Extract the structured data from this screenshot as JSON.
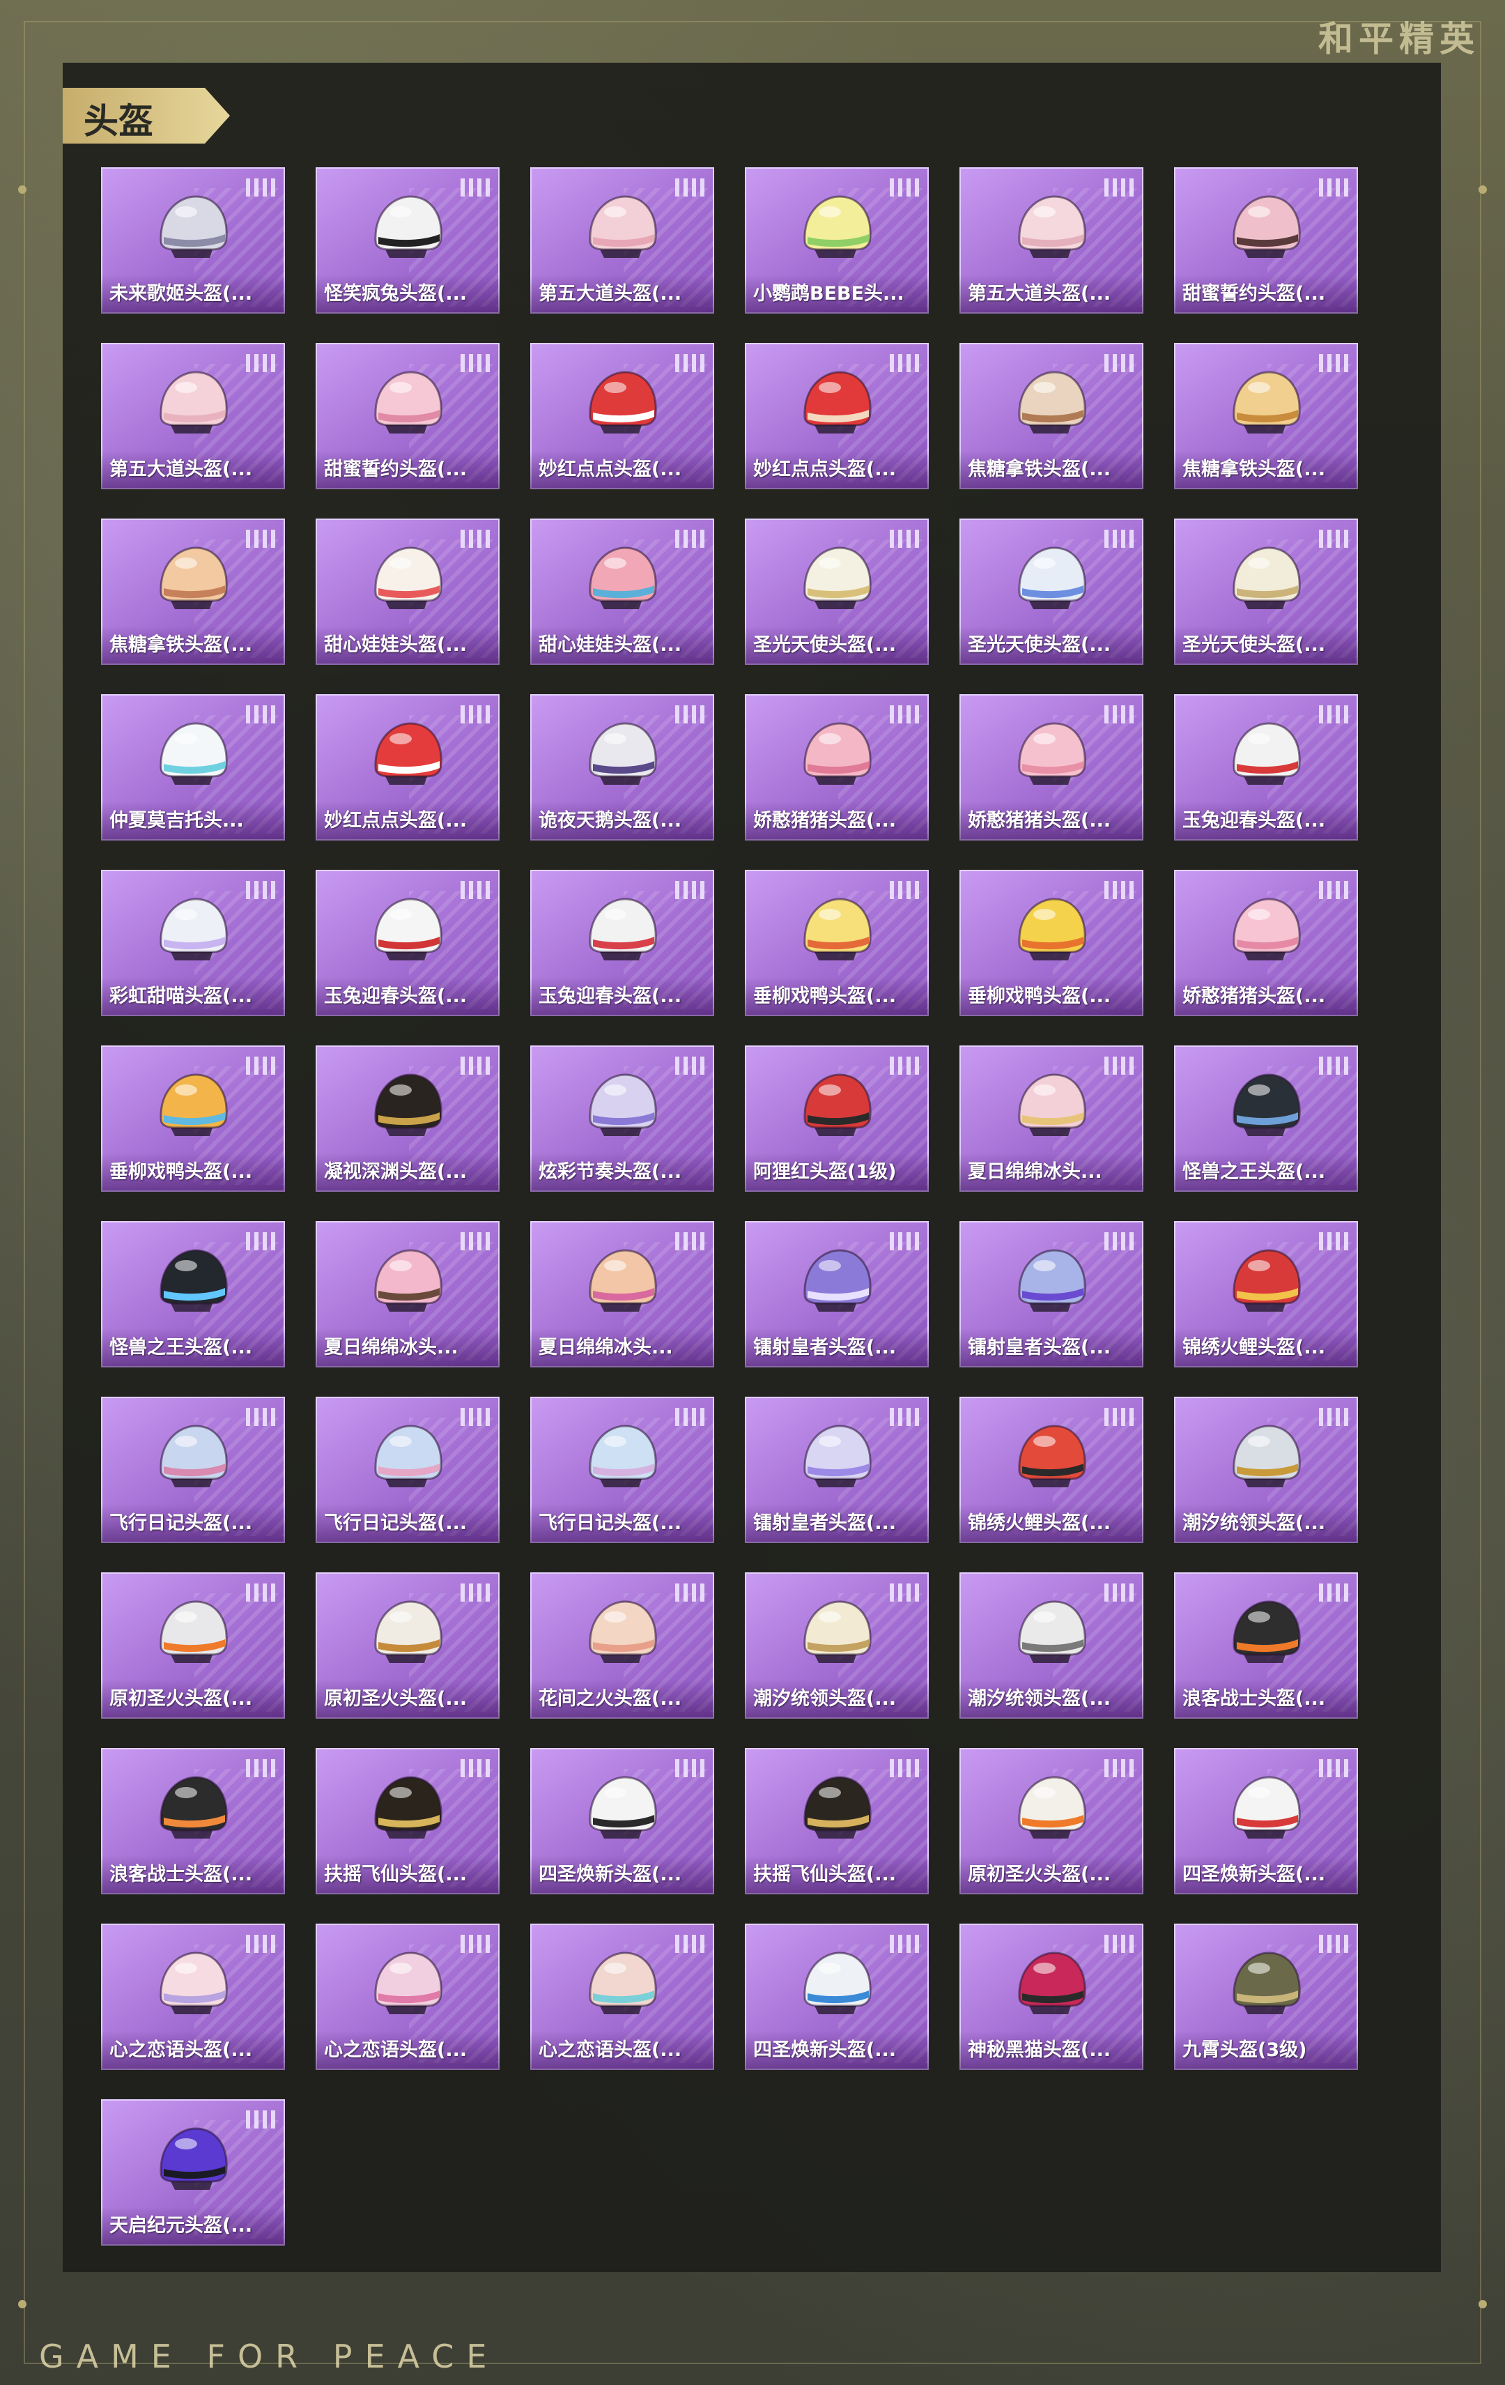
{
  "header": {
    "game_title": "和平精英"
  },
  "section": {
    "title": "头盔"
  },
  "footer": {
    "slogan": "GAME FOR PEACE"
  },
  "items": [
    {
      "name": "未来歌姬头盔(...",
      "color": "#d9d9e6",
      "accent": "#8c8ca8"
    },
    {
      "name": "怪笑疯兔头盔(...",
      "color": "#f2f2f2",
      "accent": "#222222"
    },
    {
      "name": "第五大道头盔(...",
      "color": "#f3cfd7",
      "accent": "#e8a7b5"
    },
    {
      "name": "小鹦鹉BEBE头...",
      "color": "#f3ee9a",
      "accent": "#8fcf66"
    },
    {
      "name": "第五大道头盔(...",
      "color": "#f5d7de",
      "accent": "#e4b0bb"
    },
    {
      "name": "甜蜜誓约头盔(...",
      "color": "#efc0cb",
      "accent": "#5a3a3a"
    },
    {
      "name": "第五大道头盔(...",
      "color": "#f5d2d9",
      "accent": "#e8b2bf"
    },
    {
      "name": "甜蜜誓约头盔(...",
      "color": "#f6c8d6",
      "accent": "#e08aa6"
    },
    {
      "name": "妙红点点头盔(...",
      "color": "#e03b3b",
      "accent": "#ffffff"
    },
    {
      "name": "妙红点点头盔(...",
      "color": "#e23a3a",
      "accent": "#f4d9c0"
    },
    {
      "name": "焦糖拿铁头盔(...",
      "color": "#ead4bf",
      "accent": "#b07a55"
    },
    {
      "name": "焦糖拿铁头盔(...",
      "color": "#f1cf8f",
      "accent": "#c98b3c"
    },
    {
      "name": "焦糖拿铁头盔(...",
      "color": "#f2c9a0",
      "accent": "#c6805a"
    },
    {
      "name": "甜心娃娃头盔(...",
      "color": "#f7f1ea",
      "accent": "#e85a5a"
    },
    {
      "name": "甜心娃娃头盔(...",
      "color": "#f2a7b6",
      "accent": "#5ab0d8"
    },
    {
      "name": "圣光天使头盔(...",
      "color": "#f4f1e2",
      "accent": "#d8c07a"
    },
    {
      "name": "圣光天使头盔(...",
      "color": "#e7edf7",
      "accent": "#6c8fe0"
    },
    {
      "name": "圣光天使头盔(...",
      "color": "#f2ecda",
      "accent": "#cbb37a"
    },
    {
      "name": "仲夏莫吉托头...",
      "color": "#f4f7fa",
      "accent": "#6fd0e0"
    },
    {
      "name": "妙红点点头盔(...",
      "color": "#e43c3c",
      "accent": "#ffffff"
    },
    {
      "name": "诡夜天鹅头盔(...",
      "color": "#e8e8ee",
      "accent": "#5a4a8a"
    },
    {
      "name": "娇憨猪猪头盔(...",
      "color": "#f4b7c6",
      "accent": "#e07a96"
    },
    {
      "name": "娇憨猪猪头盔(...",
      "color": "#f6c1cf",
      "accent": "#e890a6"
    },
    {
      "name": "玉兔迎春头盔(...",
      "color": "#f2f2f2",
      "accent": "#d83a3a"
    },
    {
      "name": "彩虹甜喵头盔(...",
      "color": "#eef0f8",
      "accent": "#c7b4f0"
    },
    {
      "name": "玉兔迎春头盔(...",
      "color": "#f5f5f5",
      "accent": "#d13535"
    },
    {
      "name": "玉兔迎春头盔(...",
      "color": "#f2f2f2",
      "accent": "#d8404a"
    },
    {
      "name": "垂柳戏鸭头盔(...",
      "color": "#f7df7a",
      "accent": "#e46a3a"
    },
    {
      "name": "垂柳戏鸭头盔(...",
      "color": "#f5d24c",
      "accent": "#e8732e"
    },
    {
      "name": "娇憨猪猪头盔(...",
      "color": "#f7c4d3",
      "accent": "#e689a5"
    },
    {
      "name": "垂柳戏鸭头盔(...",
      "color": "#f3b54a",
      "accent": "#5fb9e0"
    },
    {
      "name": "凝视深渊头盔(...",
      "color": "#2a2420",
      "accent": "#c9a24a"
    },
    {
      "name": "炫彩节奏头盔(...",
      "color": "#d8d2f0",
      "accent": "#8a7ad6"
    },
    {
      "name": "阿狸红头盔(1级)",
      "color": "#d83a3a",
      "accent": "#2a2a2a"
    },
    {
      "name": "夏日绵绵冰头...",
      "color": "#f3d0d8",
      "accent": "#e8c47a"
    },
    {
      "name": "怪兽之王头盔(...",
      "color": "#2a3038",
      "accent": "#6ea0d8"
    },
    {
      "name": "怪兽之王头盔(...",
      "color": "#23282e",
      "accent": "#63c7ff"
    },
    {
      "name": "夏日绵绵冰头...",
      "color": "#f3b8cc",
      "accent": "#6a4a3a"
    },
    {
      "name": "夏日绵绵冰头...",
      "color": "#f2c6a6",
      "accent": "#d86aa0"
    },
    {
      "name": "镭射皇者头盔(...",
      "color": "#8c7ad8",
      "accent": "#e8e0ff"
    },
    {
      "name": "镭射皇者头盔(...",
      "color": "#a8b4e8",
      "accent": "#6a4ad0"
    },
    {
      "name": "锦绣火鲤头盔(...",
      "color": "#d83a3a",
      "accent": "#f2c24a"
    },
    {
      "name": "飞行日记头盔(...",
      "color": "#c9d6f0",
      "accent": "#d88ab0"
    },
    {
      "name": "飞行日记头盔(...",
      "color": "#c9daf2",
      "accent": "#e6a6c6"
    },
    {
      "name": "飞行日记头盔(...",
      "color": "#cde0f4",
      "accent": "#d6b2e0"
    },
    {
      "name": "镭射皇者头盔(...",
      "color": "#d9d6f4",
      "accent": "#9d8ae6"
    },
    {
      "name": "锦绣火鲤头盔(...",
      "color": "#e34a3a",
      "accent": "#2a2a2a"
    },
    {
      "name": "潮汐统领头盔(...",
      "color": "#d9dde4",
      "accent": "#c99a3a"
    },
    {
      "name": "原初圣火头盔(...",
      "color": "#e8e8ea",
      "accent": "#ef7a2a"
    },
    {
      "name": "原初圣火头盔(...",
      "color": "#f0ece4",
      "accent": "#c58a3a"
    },
    {
      "name": "花间之火头盔(...",
      "color": "#f3d6c4",
      "accent": "#e8a08a"
    },
    {
      "name": "潮汐统领头盔(...",
      "color": "#f2ead2",
      "accent": "#c4a262"
    },
    {
      "name": "潮汐统领头盔(...",
      "color": "#eaeaea",
      "accent": "#7a7a7a"
    },
    {
      "name": "浪客战士头盔(...",
      "color": "#2e2e2e",
      "accent": "#ef7a2a"
    },
    {
      "name": "浪客战士头盔(...",
      "color": "#2c2c2c",
      "accent": "#f08a3a"
    },
    {
      "name": "扶摇飞仙头盔(...",
      "color": "#2a241c",
      "accent": "#d8b45a"
    },
    {
      "name": "四圣焕新头盔(...",
      "color": "#f4f4f4",
      "accent": "#2a2a2a"
    },
    {
      "name": "扶摇飞仙头盔(...",
      "color": "#2c2620",
      "accent": "#d6b25e"
    },
    {
      "name": "原初圣火头盔(...",
      "color": "#f3f0ea",
      "accent": "#ef7a2a"
    },
    {
      "name": "四圣焕新头盔(...",
      "color": "#f4f4f4",
      "accent": "#d83a3a"
    },
    {
      "name": "心之恋语头盔(...",
      "color": "#f6dbe2",
      "accent": "#b8a4e0"
    },
    {
      "name": "心之恋语头盔(...",
      "color": "#f2cfe0",
      "accent": "#e07aa8"
    },
    {
      "name": "心之恋语头盔(...",
      "color": "#f1d7cf",
      "accent": "#7ad0d8"
    },
    {
      "name": "四圣焕新头盔(...",
      "color": "#eef2f6",
      "accent": "#3a8ad8"
    },
    {
      "name": "神秘黑猫头盔(...",
      "color": "#c8285a",
      "accent": "#2a2a2a"
    },
    {
      "name": "九霄头盔(3级)",
      "color": "#6a6a4a",
      "accent": "#c9b47a"
    },
    {
      "name": "天启纪元头盔(...",
      "color": "#5a3ad0",
      "accent": "#1a1a24"
    }
  ]
}
